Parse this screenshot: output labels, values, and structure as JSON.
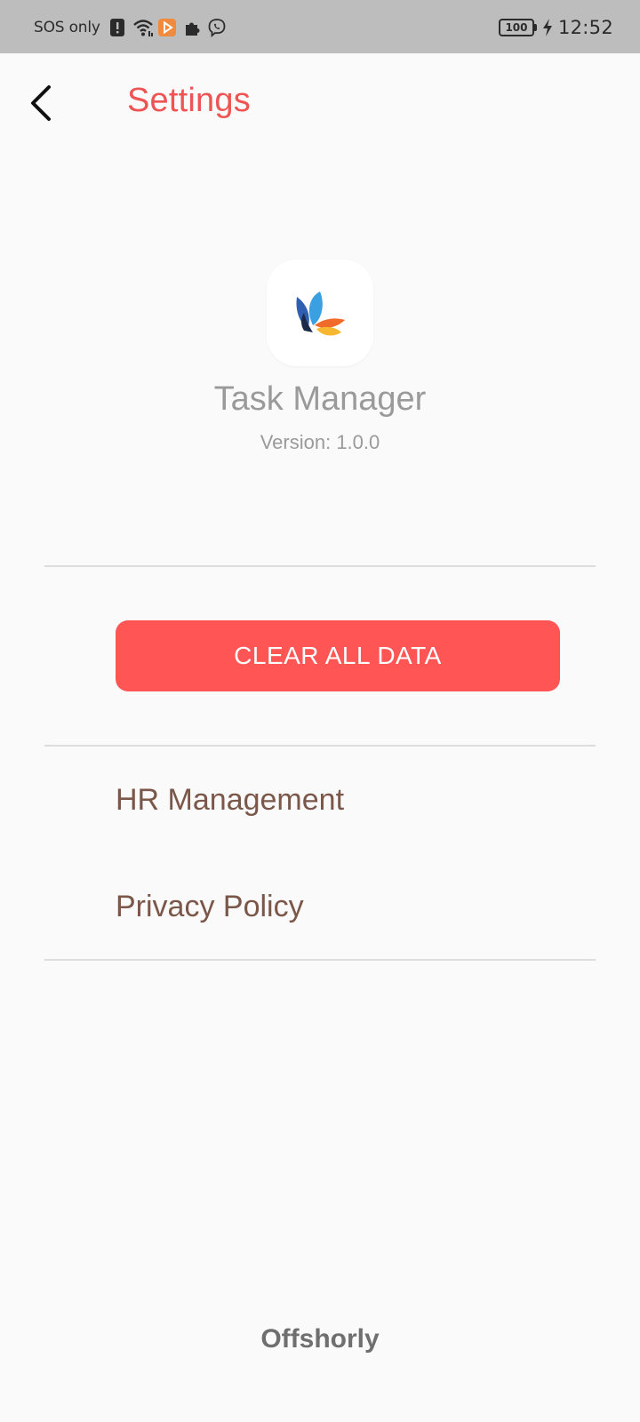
{
  "status_bar": {
    "carrier": "SOS only",
    "battery_level": "100",
    "time": "12:52",
    "icons": [
      "alert-icon",
      "wifi-icon",
      "play-store-icon",
      "puzzle-icon",
      "viber-icon",
      "battery-icon",
      "charging-icon"
    ]
  },
  "header": {
    "title": "Settings",
    "back_icon": "chevron-left-icon"
  },
  "app_info": {
    "name": "Task Manager",
    "version": "Version: 1.0.0",
    "logo_icon": "butterfly-logo-icon"
  },
  "actions": {
    "clear_all_label": "CLEAR ALL DATA"
  },
  "menu": {
    "items": [
      {
        "label": "HR Management"
      },
      {
        "label": "Privacy Policy"
      }
    ]
  },
  "footer": {
    "brand": "Offshorly"
  },
  "colors": {
    "accent": "#ee5454",
    "button_bg": "#ff5555",
    "menu_text": "#7a5749",
    "muted_text": "#9a9a9a",
    "status_bar_bg": "#bdbdbd",
    "background": "#fafafa"
  }
}
